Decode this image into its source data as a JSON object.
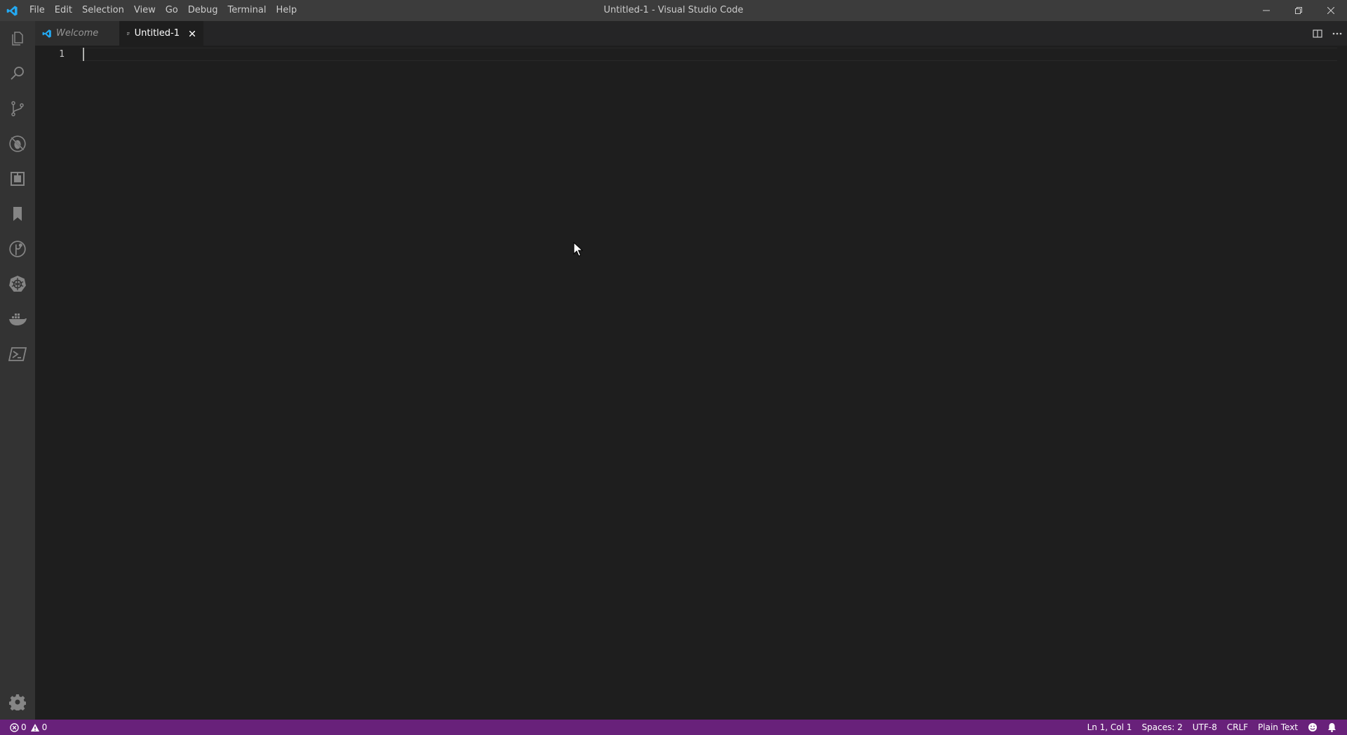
{
  "window": {
    "title": "Untitled-1 - Visual Studio Code",
    "menu": [
      "File",
      "Edit",
      "Selection",
      "View",
      "Go",
      "Debug",
      "Terminal",
      "Help"
    ]
  },
  "activity_bar": {
    "icons": [
      "explorer-icon",
      "search-icon",
      "source-control-icon",
      "debug-icon",
      "extensions-icon",
      "bookmarks-icon",
      "gitlens-icon",
      "kubernetes-icon",
      "docker-icon",
      "powershell-icon"
    ],
    "bottom_icon": "gear-icon"
  },
  "tabs": [
    {
      "label": "Welcome",
      "active": false
    },
    {
      "label": "Untitled-1",
      "active": true
    }
  ],
  "editor": {
    "line_numbers": [
      "1"
    ]
  },
  "status_bar": {
    "errors": "0",
    "warnings": "0",
    "position": "Ln 1, Col 1",
    "spaces": "Spaces: 2",
    "encoding": "UTF-8",
    "eol": "CRLF",
    "language": "Plain Text",
    "background_color": "#68217a"
  },
  "colors": {
    "titlebar": "#3c3c3c",
    "activitybar": "#333333",
    "editor": "#1e1e1e",
    "accent": "#0078d4"
  }
}
